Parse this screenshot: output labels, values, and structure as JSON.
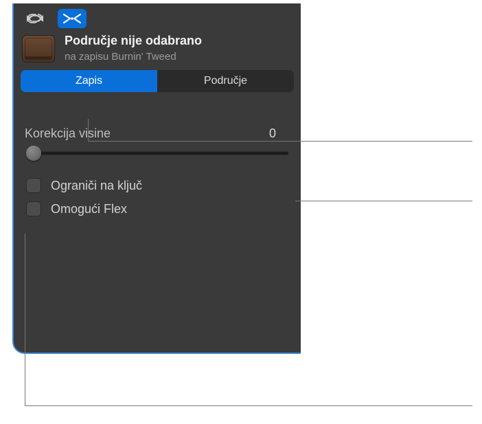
{
  "toolbar": {
    "icon1": "loop-icon",
    "icon2": "split-merge-icon"
  },
  "header": {
    "title": "Područje nije odabrano",
    "subtitle": "na zapisu Burnin' Tweed"
  },
  "tabs": {
    "items": [
      {
        "label": "Zapis",
        "active": true
      },
      {
        "label": "Područje",
        "active": false
      }
    ]
  },
  "controls": {
    "pitch": {
      "label": "Korekcija visine",
      "value": "0"
    },
    "limitKey": {
      "label": "Ograniči na ključ",
      "checked": false
    },
    "enableFlex": {
      "label": "Omogući Flex",
      "checked": false
    }
  }
}
